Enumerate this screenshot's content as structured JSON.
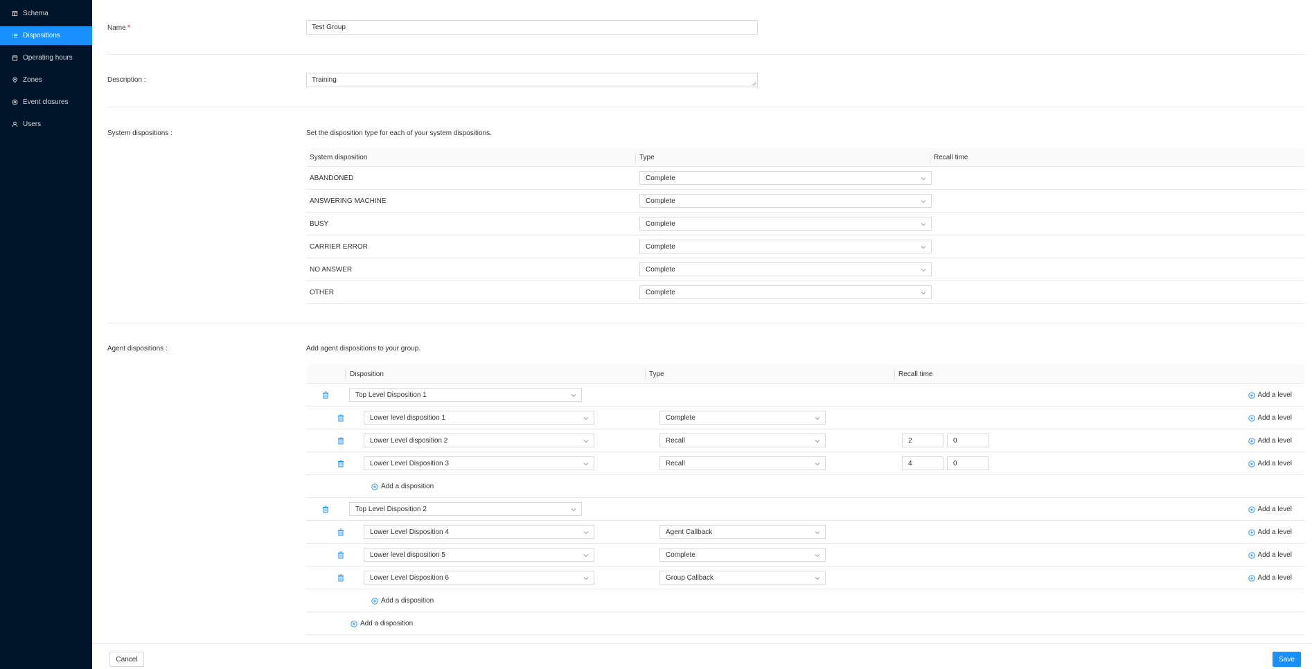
{
  "sidebar": {
    "items": [
      {
        "label": "Schema",
        "icon": "schema-icon"
      },
      {
        "label": "Dispositions",
        "icon": "list-icon",
        "active": true
      },
      {
        "label": "Operating hours",
        "icon": "calendar-icon"
      },
      {
        "label": "Zones",
        "icon": "location-icon"
      },
      {
        "label": "Event closures",
        "icon": "closure-icon"
      },
      {
        "label": "Users",
        "icon": "user-icon"
      }
    ]
  },
  "form": {
    "name_label": "Name",
    "name_required": "*",
    "name_value": "Test Group",
    "description_label": "Description :",
    "description_value": "Training",
    "system_label": "System dispositions :",
    "system_helper": "Set the disposition type for each of your system dispositions.",
    "agent_label": "Agent dispositions :",
    "agent_helper": "Add agent dispositions to your group."
  },
  "system_table": {
    "headers": [
      "System disposition",
      "Type",
      "Recall time"
    ],
    "rows": [
      {
        "name": "ABANDONED",
        "type": "Complete"
      },
      {
        "name": "ANSWERING MACHINE",
        "type": "Complete"
      },
      {
        "name": "BUSY",
        "type": "Complete"
      },
      {
        "name": "CARRIER ERROR",
        "type": "Complete"
      },
      {
        "name": "NO ANSWER",
        "type": "Complete"
      },
      {
        "name": "OTHER",
        "type": "Complete"
      }
    ]
  },
  "agent_table": {
    "headers": [
      "Disposition",
      "Type",
      "Recall time"
    ],
    "add_level": "Add a level",
    "add_disposition": "Add a disposition",
    "groups": [
      {
        "name": "Top Level Disposition 1",
        "children": [
          {
            "name": "Lower level disposition 1",
            "type": "Complete"
          },
          {
            "name": "Lower Level disposition 2",
            "type": "Recall",
            "recall": [
              "2",
              "0"
            ]
          },
          {
            "name": "Lower Level Disposition 3",
            "type": "Recall",
            "recall": [
              "4",
              "0"
            ]
          }
        ]
      },
      {
        "name": "Top Level Disposition 2",
        "children": [
          {
            "name": "Lower Level Disposition 4",
            "type": "Agent Callback"
          },
          {
            "name": "Lower level disposition 5",
            "type": "Complete"
          },
          {
            "name": "Lower Level Disposition 6",
            "type": "Group Callback"
          }
        ]
      }
    ]
  },
  "footer": {
    "cancel": "Cancel",
    "save": "Save"
  },
  "colors": {
    "sidebar_bg": "#001529",
    "accent": "#1890ff",
    "required": "#f5222d"
  }
}
